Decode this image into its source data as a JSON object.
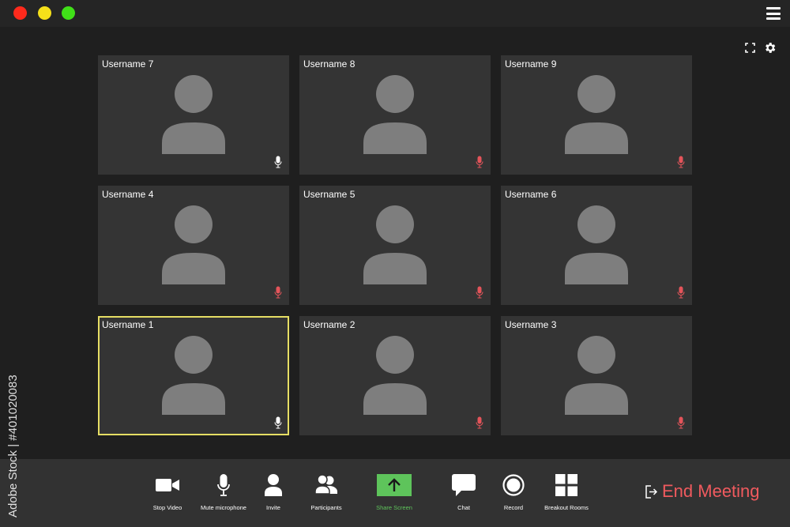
{
  "colors": {
    "background": "#1f1f1f",
    "titlebar": "#252525",
    "tile": "#343434",
    "avatar": "#7e7e7e",
    "active_border": "#e6de64",
    "muted_mic": "#e4545a",
    "share_green": "#5ec45b",
    "end_red": "#f05a5e"
  },
  "window": {
    "controls": [
      "close-icon",
      "minimize-icon",
      "maximize-icon"
    ],
    "menu_icon": "hamburger-icon"
  },
  "view_controls": [
    "fullscreen-icon",
    "gear-icon"
  ],
  "participants": [
    {
      "name": "Username 7",
      "mic": "on",
      "active": false
    },
    {
      "name": "Username 8",
      "mic": "muted",
      "active": false
    },
    {
      "name": "Username 9",
      "mic": "muted",
      "active": false
    },
    {
      "name": "Username 4",
      "mic": "muted",
      "active": false
    },
    {
      "name": "Username 5",
      "mic": "muted",
      "active": false
    },
    {
      "name": "Username 6",
      "mic": "muted",
      "active": false
    },
    {
      "name": "Username 1",
      "mic": "on",
      "active": true
    },
    {
      "name": "Username 2",
      "mic": "muted",
      "active": false
    },
    {
      "name": "Username 3",
      "mic": "muted",
      "active": false
    }
  ],
  "toolbar": {
    "items": [
      {
        "id": "stop-video",
        "label": "Stop Video",
        "icon": "video-camera-icon"
      },
      {
        "id": "mute-microphone",
        "label": "Mute microphone",
        "icon": "microphone-icon"
      },
      {
        "id": "invite",
        "label": "Invite",
        "icon": "person-icon"
      },
      {
        "id": "participants",
        "label": "Participants",
        "icon": "people-icon"
      },
      {
        "id": "share-screen",
        "label": "Share Screen",
        "icon": "share-arrow-icon"
      },
      {
        "id": "chat",
        "label": "Chat",
        "icon": "chat-bubble-icon"
      },
      {
        "id": "record",
        "label": "Record",
        "icon": "record-icon"
      },
      {
        "id": "breakout-rooms",
        "label": "Breakout Rooms",
        "icon": "grid-icon"
      }
    ],
    "end_meeting": {
      "label": "End Meeting",
      "icon": "exit-icon"
    }
  },
  "watermark": {
    "id_text": "Adobe Stock | #401020083"
  }
}
